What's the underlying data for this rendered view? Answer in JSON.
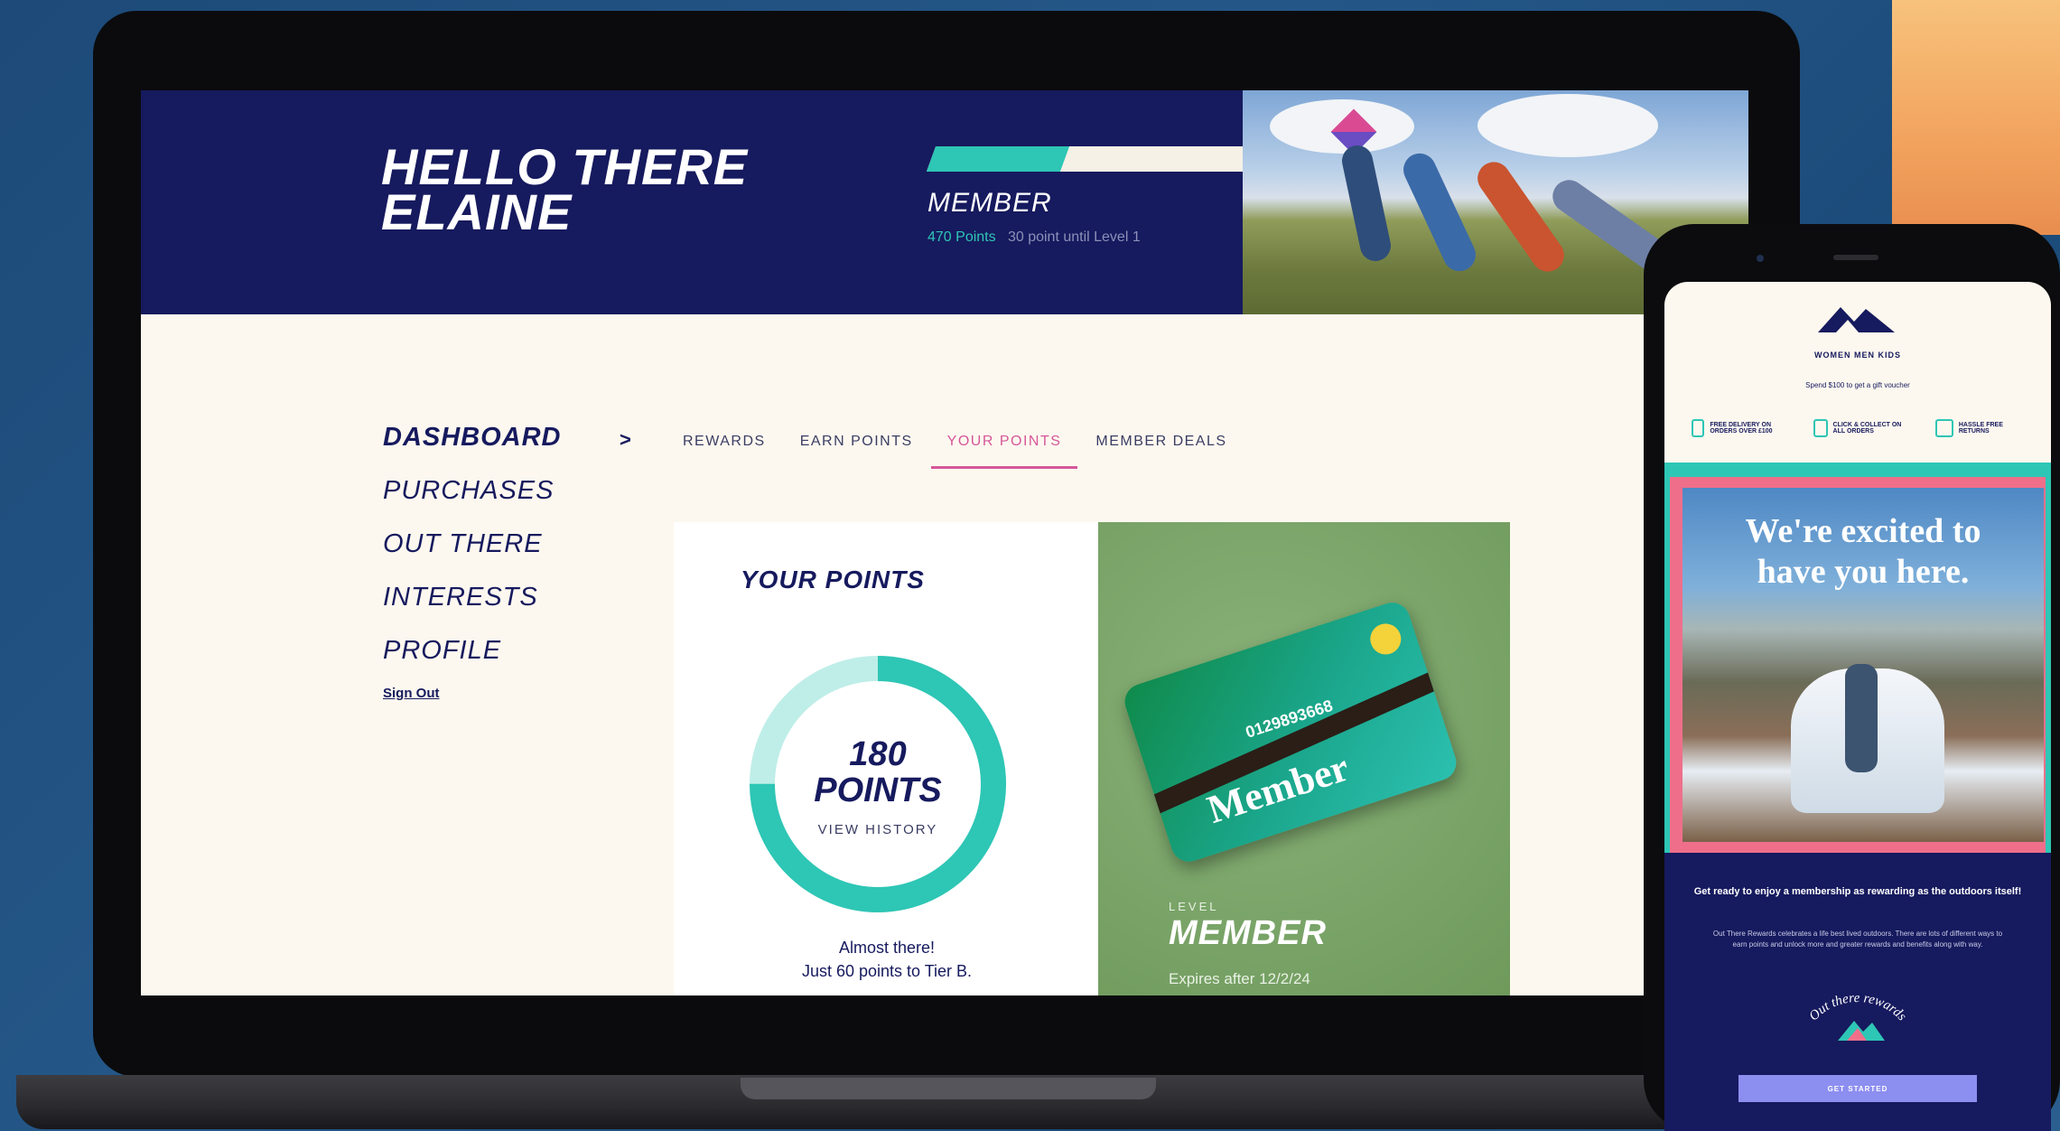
{
  "colors": {
    "navy": "#161a5e",
    "teal": "#2ec6b5",
    "pink": "#d5579a",
    "cream": "#fdf8ef",
    "green": "#7ea86d"
  },
  "header": {
    "greeting_line1": "HELLO THERE",
    "greeting_line2": "ELAINE",
    "tier": "MEMBER",
    "points_text": "470 Points",
    "points_remaining": "30 point until Level 1",
    "progress_fraction": 0.36
  },
  "sidebar": {
    "items": [
      {
        "label": "DASHBOARD"
      },
      {
        "label": "PURCHASES"
      },
      {
        "label": "OUT THERE"
      },
      {
        "label": "INTERESTS"
      },
      {
        "label": "PROFILE"
      }
    ],
    "signout": "Sign Out",
    "chevron": ">"
  },
  "tabs": [
    {
      "label": "REWARDS"
    },
    {
      "label": "EARN POINTS"
    },
    {
      "label": "YOUR POINTS"
    },
    {
      "label": "MEMBER DEALS"
    }
  ],
  "points_card": {
    "title": "YOUR POINTS",
    "value": "180",
    "unit": "POINTS",
    "link": "VIEW HISTORY",
    "message_line1": "Almost there!",
    "message_line2": "Just 60 points to Tier B.",
    "ring_fraction": 0.75
  },
  "member_card": {
    "card_number": "0129893668",
    "card_word": "Member",
    "level_label": "LEVEL",
    "level_name": "MEMBER",
    "expires": "Expires after 12/2/24"
  },
  "phone": {
    "nav": "WOMEN  MEN  KIDS",
    "promo": "Spend $100 to get a gift voucher",
    "features": [
      {
        "icon": "truck-icon",
        "label": "FREE DELIVERY ON ORDERS OVER £100"
      },
      {
        "icon": "store-icon",
        "label": "CLICK & COLLECT ON ALL ORDERS"
      },
      {
        "icon": "box-icon",
        "label": "HASSLE FREE RETURNS"
      }
    ],
    "headline_line1": "We're excited to",
    "headline_line2": "have you here.",
    "lead": "Get ready to enjoy a membership as rewarding as the outdoors itself!",
    "body": "Out There Rewards celebrates a life best lived outdoors. There are lots of different ways to earn points and unlock more and greater rewards and benefits along with way.",
    "badge_text": "Out there rewards",
    "button": "GET STARTED"
  }
}
